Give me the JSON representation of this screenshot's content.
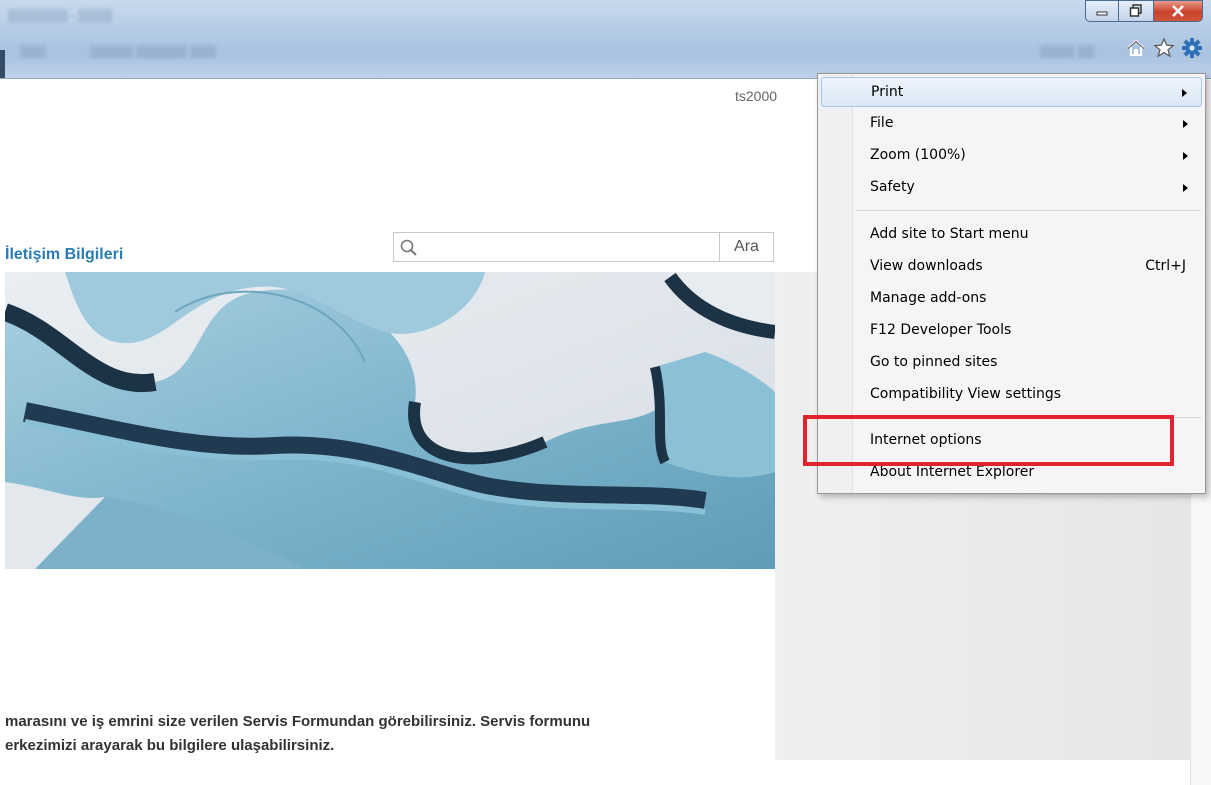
{
  "page": {
    "username": "ts2000",
    "contact_link": "İletişim Bilgileri",
    "search": {
      "placeholder": "",
      "value": "",
      "button_label": "Ara"
    },
    "body_lines": [
      "marasını ve iş emrini size verilen Servis Formundan görebilirsiniz. Servis formunu",
      "erkezimizi arayarak bu bilgilere ulaşabilirsiniz."
    ]
  },
  "menu": {
    "items": [
      {
        "label": "Print",
        "shortcut": "",
        "submenu": true
      },
      {
        "label": "File",
        "shortcut": "",
        "submenu": true
      },
      {
        "label": "Zoom (100%)",
        "shortcut": "",
        "submenu": true
      },
      {
        "label": "Safety",
        "shortcut": "",
        "submenu": true
      },
      {
        "label": "Add site to Start menu",
        "shortcut": "",
        "submenu": false
      },
      {
        "label": "View downloads",
        "shortcut": "Ctrl+J",
        "submenu": false
      },
      {
        "label": "Manage add-ons",
        "shortcut": "",
        "submenu": false
      },
      {
        "label": "F12 Developer Tools",
        "shortcut": "",
        "submenu": false
      },
      {
        "label": "Go to pinned sites",
        "shortcut": "",
        "submenu": false
      },
      {
        "label": "Compatibility View settings",
        "shortcut": "",
        "submenu": false
      },
      {
        "label": "Internet options",
        "shortcut": "",
        "submenu": false
      },
      {
        "label": "About Internet Explorer",
        "shortcut": "",
        "submenu": false
      }
    ],
    "highlighted_item": "Print"
  },
  "colors": {
    "link_blue": "#2a7db4",
    "highlight_box": "#e0232e",
    "gear_blue": "#2f6fb7"
  },
  "icons": [
    "home-icon",
    "star-icon",
    "gear-icon",
    "search-icon",
    "minimize-icon",
    "restore-icon",
    "close-icon"
  ]
}
